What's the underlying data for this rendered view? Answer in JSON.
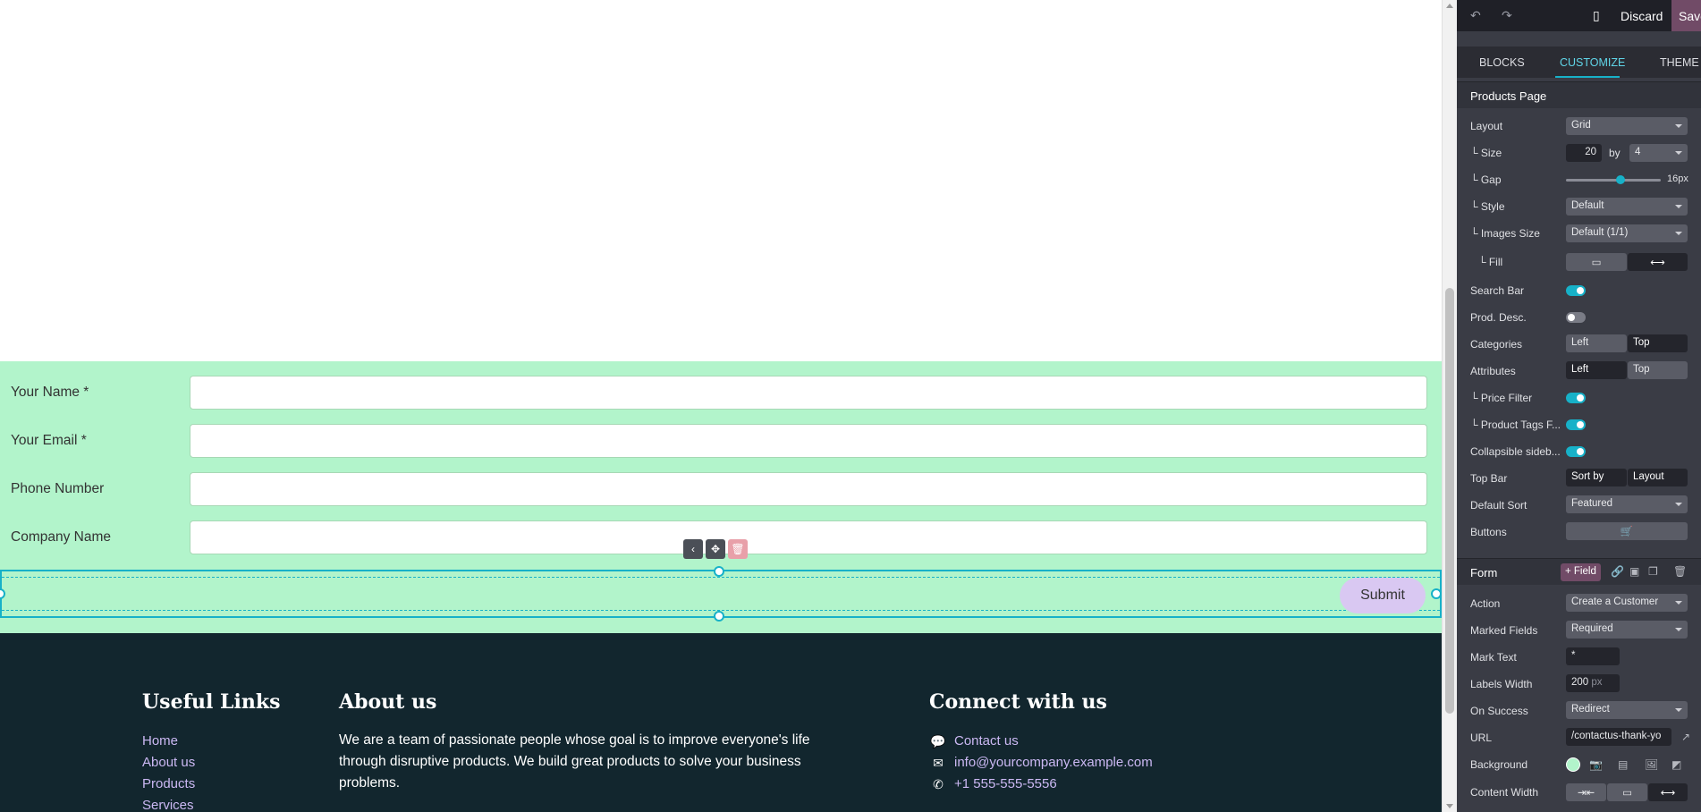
{
  "form": {
    "rows": [
      {
        "label": "Your Name",
        "required_mark": "*"
      },
      {
        "label": "Your Email",
        "required_mark": "*"
      },
      {
        "label": "Phone Number",
        "required_mark": ""
      },
      {
        "label": "Company Name",
        "required_mark": ""
      }
    ],
    "submit_label": "Submit",
    "background_color": "#b2f4cb"
  },
  "footer": {
    "col1_title": "Useful Links",
    "links": [
      "Home",
      "About us",
      "Products",
      "Services"
    ],
    "col2_title": "About us",
    "about_text": "We are a team of passionate people whose goal is to improve everyone's life through disruptive products. We build great products to solve your business problems.",
    "col3_title": "Connect with us",
    "contact_label": "Contact us",
    "email": "info@yourcompany.example.com",
    "phone": "+1 555-555-5556",
    "background_color": "#12262e"
  },
  "panel": {
    "discard_label": "Discard",
    "save_label": "Save",
    "tabs": [
      "BLOCKS",
      "CUSTOMIZE",
      "THEME"
    ],
    "active_tab": "CUSTOMIZE",
    "products_section": {
      "title": "Products Page",
      "layout_label": "Layout",
      "layout_value": "Grid",
      "size_label": "└ Size",
      "size_value": "20",
      "size_by": "by",
      "size_cols": "4",
      "gap_label": "└ Gap",
      "gap_value": "16px",
      "style_label": "└ Style",
      "style_value": "Default",
      "images_size_label": "└ Images Size",
      "images_size_value": "Default (1/1)",
      "fill_label": "└ Fill",
      "search_bar_label": "Search Bar",
      "search_bar_on": true,
      "prod_desc_label": "Prod. Desc.",
      "prod_desc_on": false,
      "categories_label": "Categories",
      "categories_options": [
        "Left",
        "Top"
      ],
      "categories_selected": "Top",
      "attributes_label": "Attributes",
      "attributes_options": [
        "Left",
        "Top"
      ],
      "attributes_selected": "Left",
      "price_filter_label": "└ Price Filter",
      "price_filter_on": true,
      "product_tags_label": "└ Product Tags F...",
      "product_tags_on": true,
      "collapsible_label": "Collapsible sideb...",
      "collapsible_on": true,
      "top_bar_label": "Top Bar",
      "top_bar_options": [
        "Sort by",
        "Layout"
      ],
      "default_sort_label": "Default Sort",
      "default_sort_value": "Featured",
      "buttons_label": "Buttons"
    },
    "form_section": {
      "title": "Form",
      "add_field_label": "+ Field",
      "action_label": "Action",
      "action_value": "Create a Customer",
      "marked_fields_label": "Marked Fields",
      "marked_fields_value": "Required",
      "mark_text_label": "Mark Text",
      "mark_text_value": "*",
      "labels_width_label": "Labels Width",
      "labels_width_value": "200",
      "labels_width_unit": "px",
      "on_success_label": "On Success",
      "on_success_value": "Redirect",
      "url_label": "URL",
      "url_value": "/contactus-thank-yo",
      "background_label": "Background",
      "content_width_label": "Content Width"
    }
  }
}
